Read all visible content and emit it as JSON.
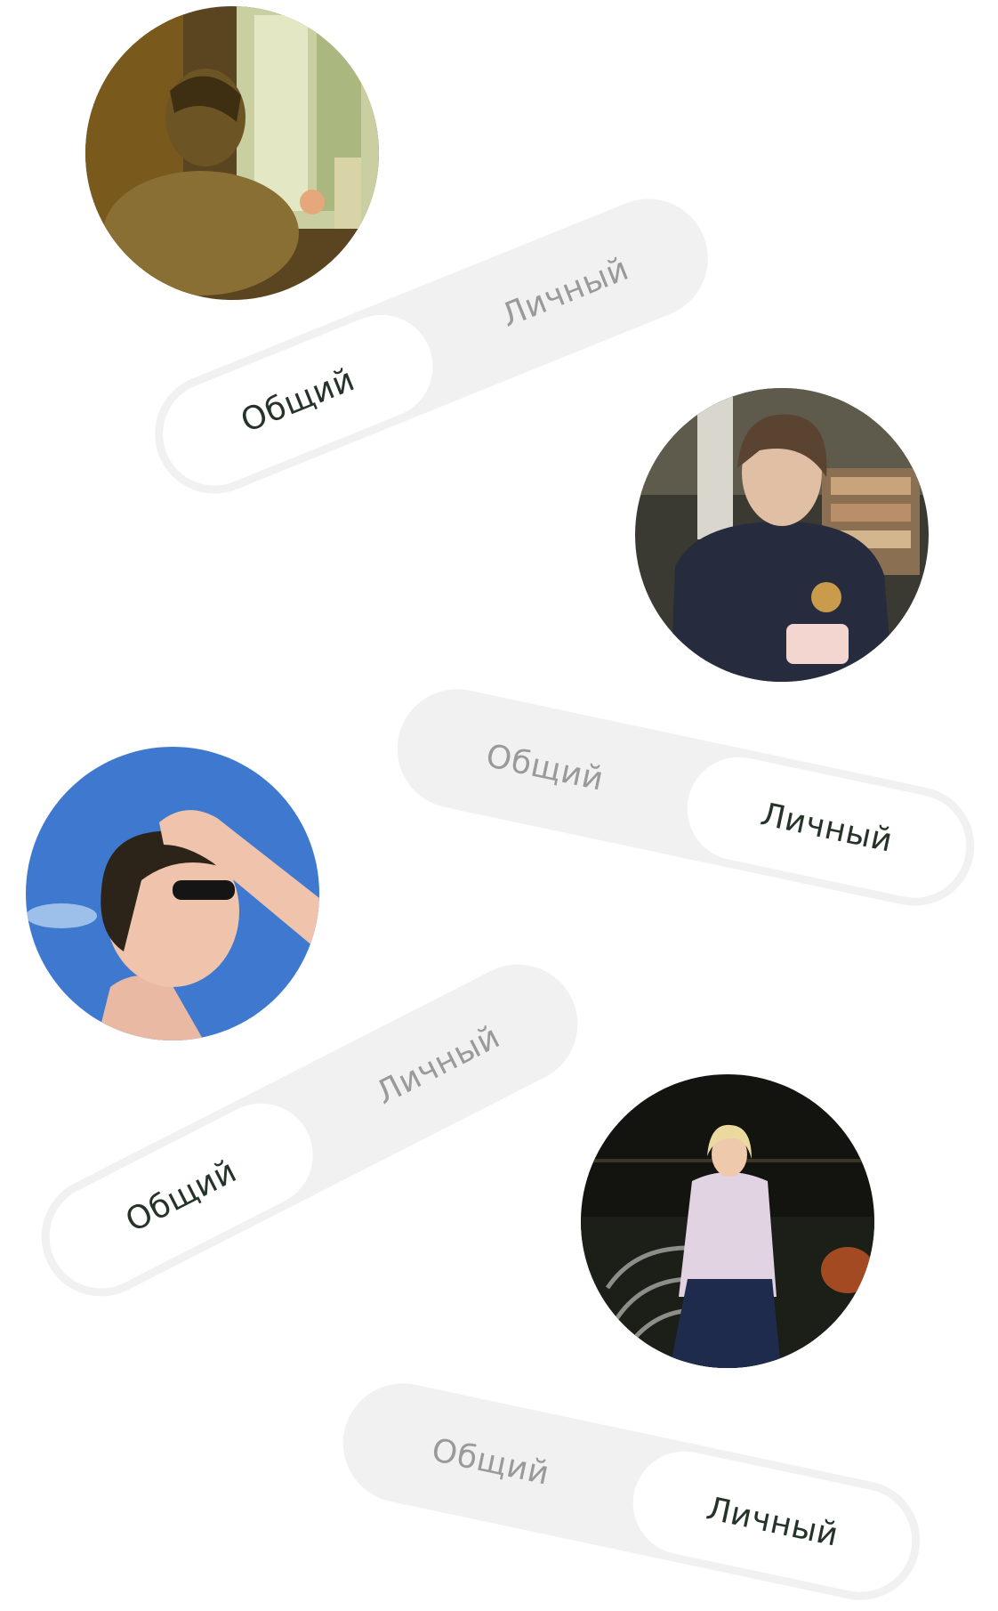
{
  "cards": [
    {
      "avatar_icon": "person-photo-icon",
      "toggle": {
        "options": [
          "Общий",
          "Личный"
        ],
        "selected": "Общий"
      }
    },
    {
      "avatar_icon": "person-photo-icon",
      "toggle": {
        "options": [
          "Общий",
          "Личный"
        ],
        "selected": "Личный"
      }
    },
    {
      "avatar_icon": "person-photo-icon",
      "toggle": {
        "options": [
          "Общий",
          "Личный"
        ],
        "selected": "Общий"
      }
    },
    {
      "avatar_icon": "person-photo-icon",
      "toggle": {
        "options": [
          "Общий",
          "Личный"
        ],
        "selected": "Личный"
      }
    }
  ],
  "colors": {
    "toggle_track": "#f1f1f1",
    "toggle_active_bg": "#ffffff",
    "toggle_active_text": "#263329",
    "toggle_inactive_text": "#9a9a9a"
  }
}
